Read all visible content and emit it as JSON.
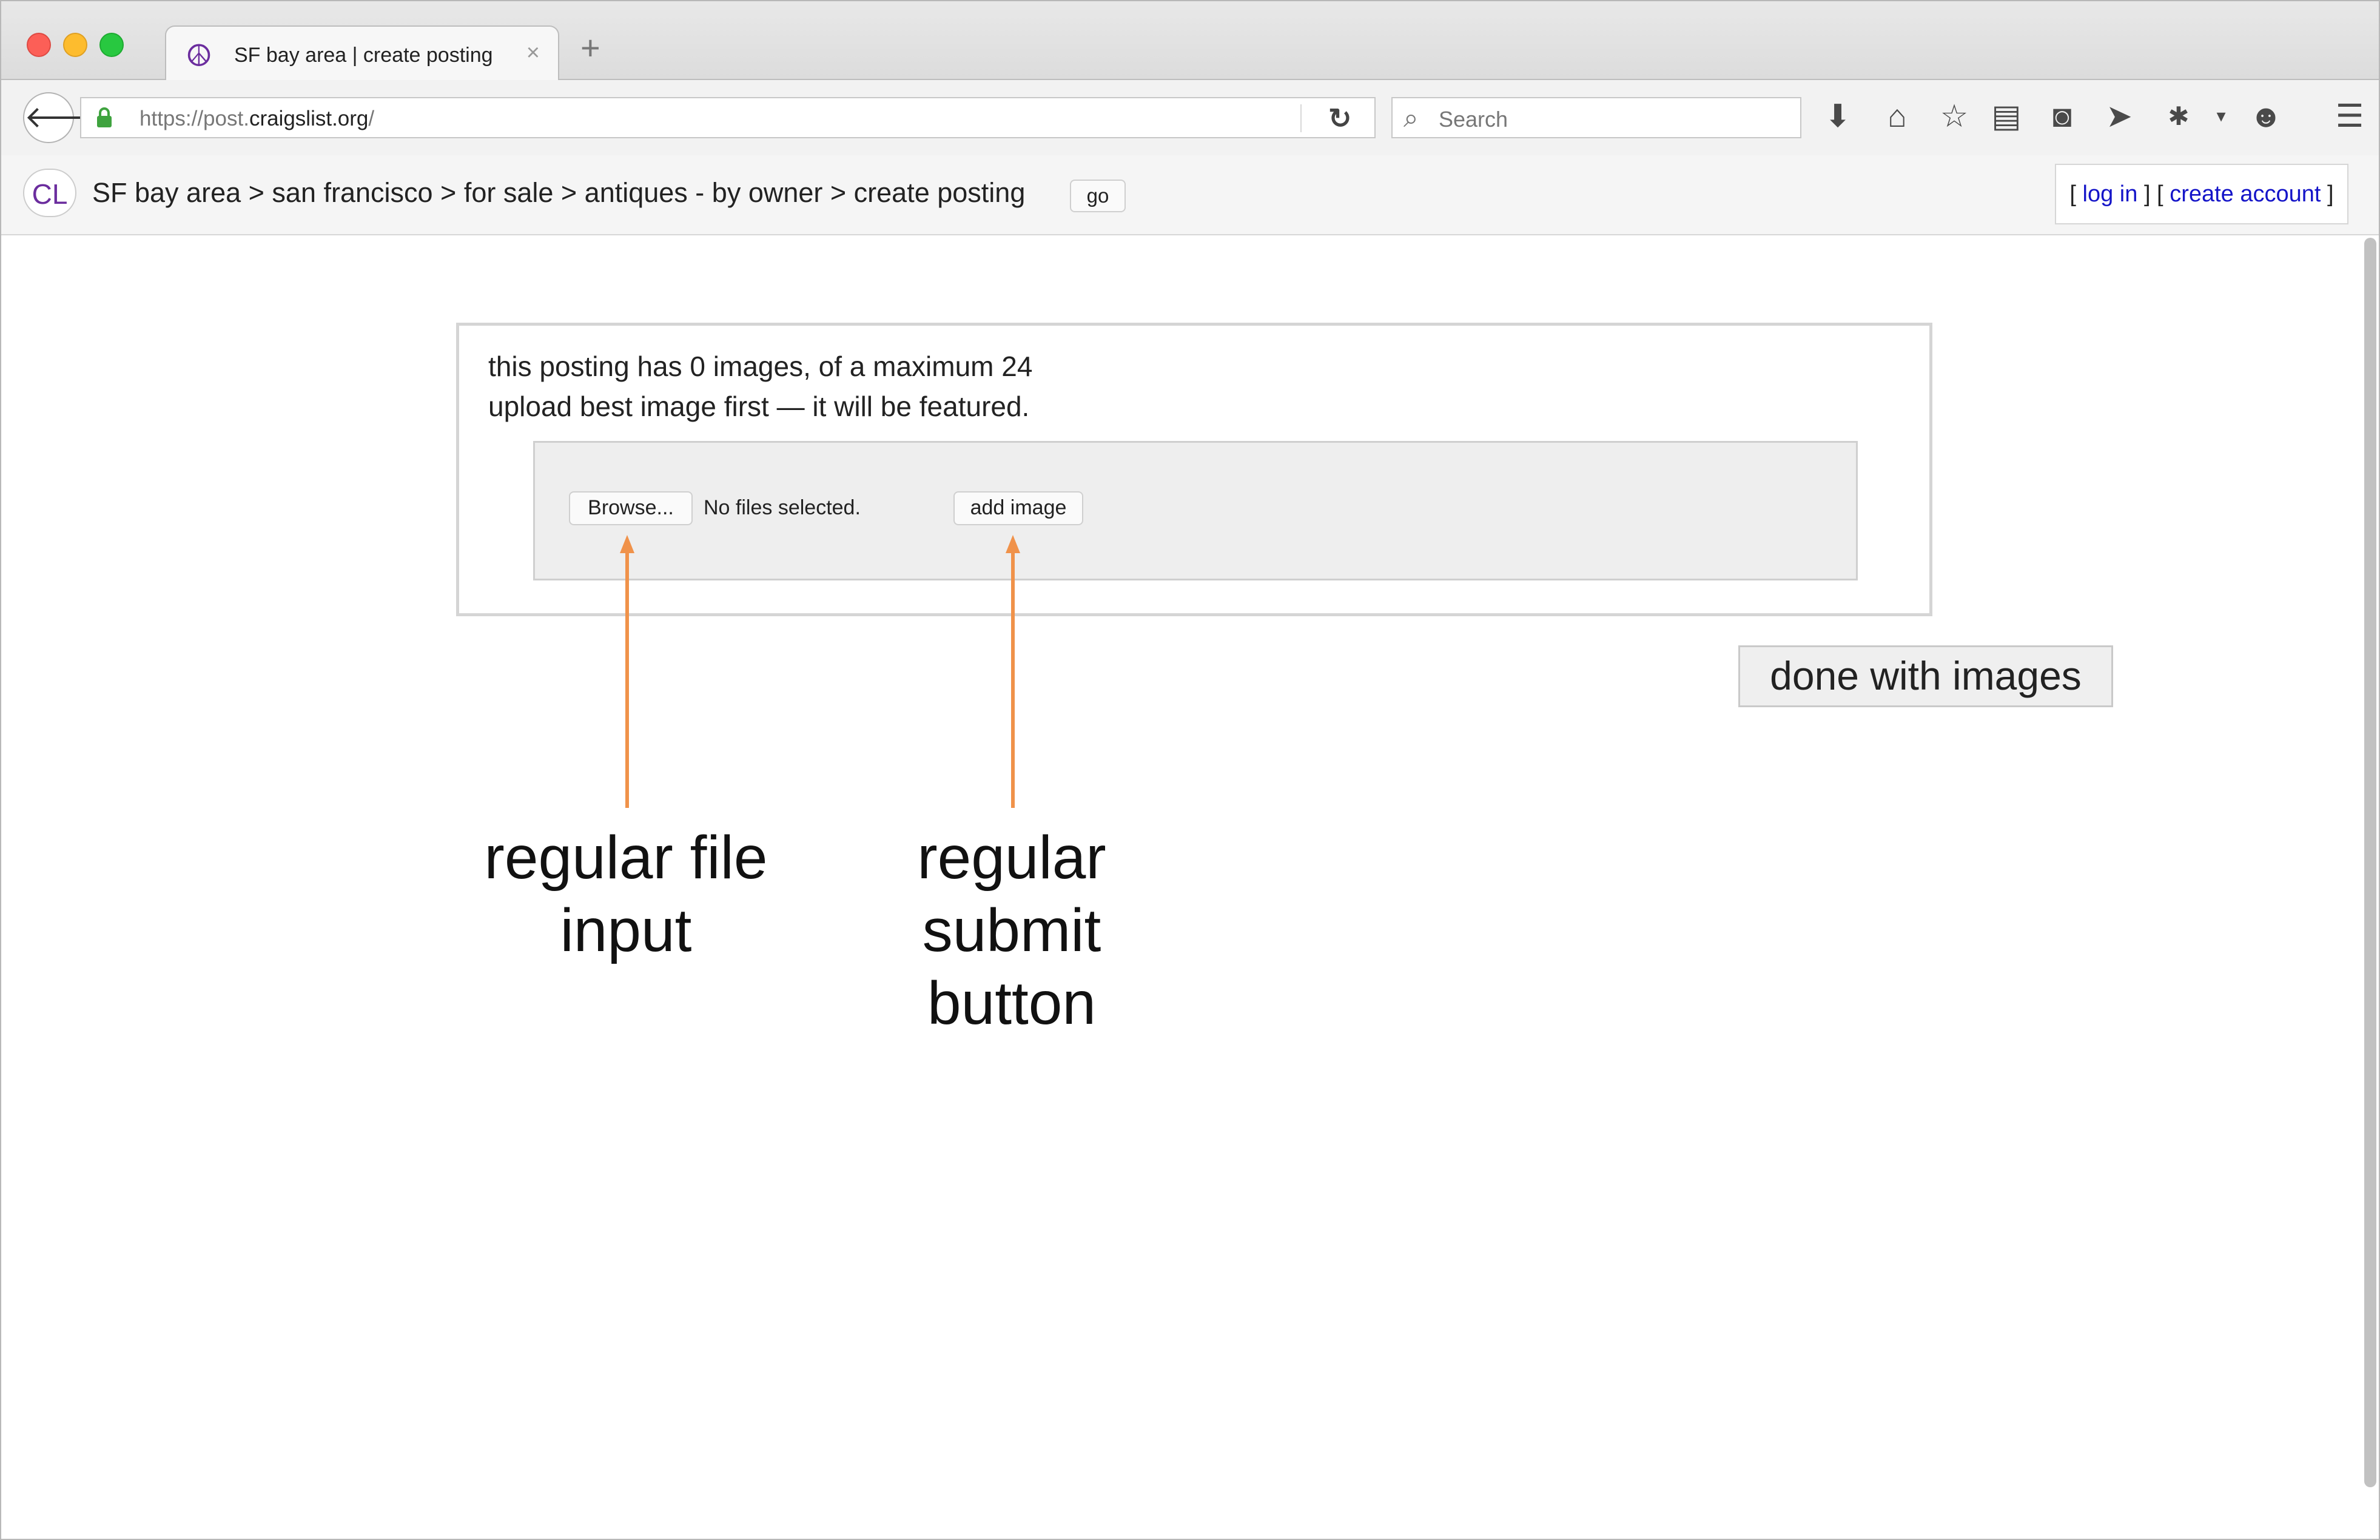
{
  "tab": {
    "title": "SF bay area | create posting",
    "close_symbol": "×",
    "new_tab_symbol": "+"
  },
  "address_bar": {
    "url_prefix": "https://post.",
    "url_domain": "craigslist.org",
    "url_suffix": "/"
  },
  "search": {
    "placeholder": "Search"
  },
  "breadcrumb": {
    "logo": "CL",
    "path": "SF bay area > san francisco > for sale > antiques - by owner > create posting",
    "go_label": "go"
  },
  "account": {
    "bracket_open": "[",
    "login": "log in",
    "separator": "] [",
    "create": "create account",
    "bracket_close": "]"
  },
  "upload_panel": {
    "info_line1": "this posting has 0 images, of a maximum 24",
    "info_line2": "upload best image first — it will be featured.",
    "browse_label": "Browse...",
    "file_status": "No files selected.",
    "add_image_label": "add image"
  },
  "done_button": {
    "label": "done with images"
  },
  "annotations": {
    "file_input_line1": "regular file",
    "file_input_line2": "input",
    "submit_line1": "regular",
    "submit_line2": "submit",
    "submit_line3": "button",
    "arrow_color": "#f0924a"
  },
  "toolbar_icons": [
    "downloads-icon",
    "home-icon",
    "bookmark-star-icon",
    "reading-list-icon",
    "pocket-icon",
    "send-icon",
    "extension-icon",
    "menu-dropdown-icon",
    "chat-icon",
    "hamburger-menu-icon"
  ]
}
